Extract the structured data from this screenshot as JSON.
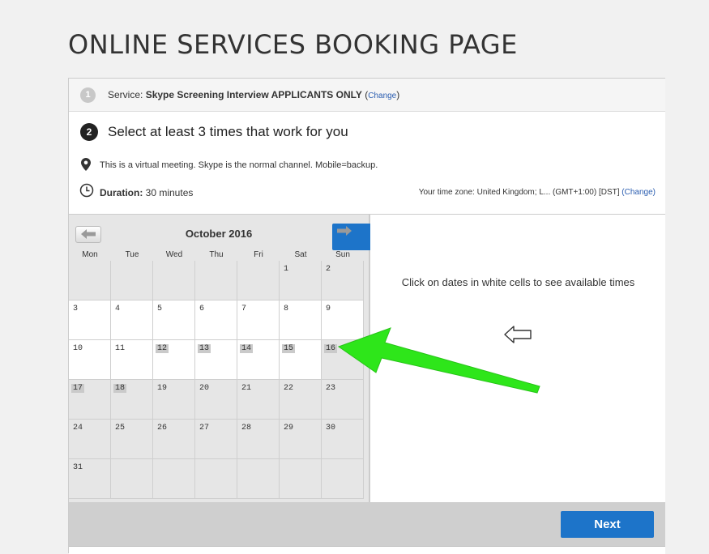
{
  "page": {
    "title": "ONLINE SERVICES BOOKING PAGE"
  },
  "step1": {
    "number": "1",
    "prefix": "Service: ",
    "service": "Skype Screening Interview APPLICANTS ONLY",
    "change_open": " (",
    "change": "Change",
    "change_close": ")"
  },
  "step2": {
    "number": "2",
    "title": "Select at least 3 times that work for you",
    "virtual": "This is a virtual meeting. Skype is the normal channel. Mobile=backup.",
    "duration_label": "Duration:",
    "duration_value": " 30 minutes",
    "timezone": "Your time zone: United Kingdom; L... (GMT+1:00) [DST] ",
    "tz_change": "(Change)"
  },
  "calendar": {
    "month": "October 2016",
    "weekdays": [
      "Mon",
      "Tue",
      "Wed",
      "Thu",
      "Fri",
      "Sat",
      "Sun"
    ],
    "weeks": [
      [
        "",
        "",
        "",
        "",
        "",
        "1",
        "2"
      ],
      [
        "3",
        "4",
        "5",
        "6",
        "7",
        "8",
        "9"
      ],
      [
        "10",
        "11",
        "12",
        "13",
        "14",
        "15",
        "16"
      ],
      [
        "17",
        "18",
        "19",
        "20",
        "21",
        "22",
        "23"
      ],
      [
        "24",
        "25",
        "26",
        "27",
        "28",
        "29",
        "30"
      ],
      [
        "31",
        "",
        "",
        "",
        "",
        "",
        ""
      ]
    ]
  },
  "panel": {
    "hint": "Click on dates in white cells to see available times"
  },
  "footer": {
    "next_label": "Next"
  },
  "icons": {
    "prev": "arrow-left-icon",
    "next": "arrow-right-icon",
    "pin": "map-pin-icon",
    "clock": "clock-icon",
    "hint": "outline-arrow-left-icon",
    "annotation": "green-arrow-icon"
  },
  "colors": {
    "accent": "#1d74c9",
    "annotation": "#2ee61a",
    "link": "#2a5db0"
  }
}
